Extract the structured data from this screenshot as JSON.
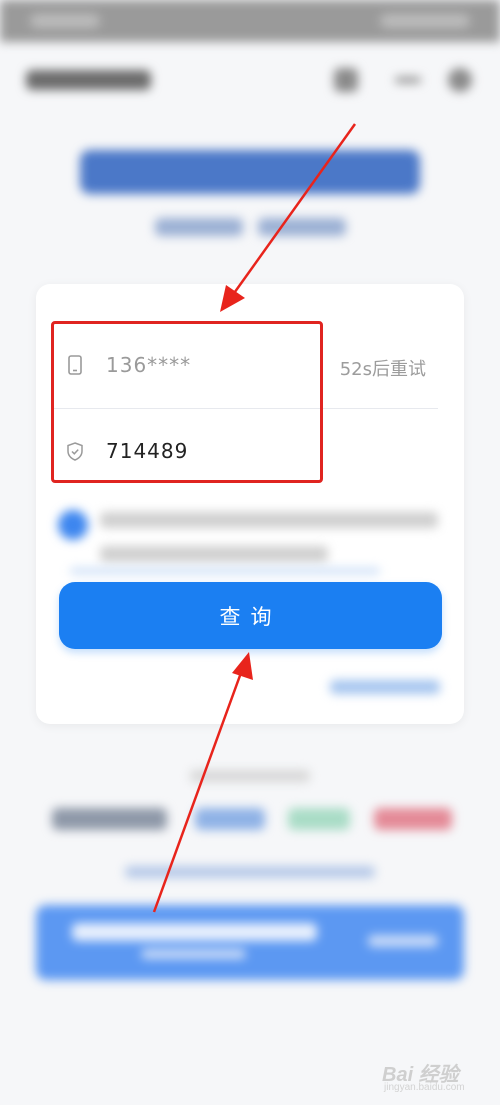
{
  "form": {
    "phone_value": "136****",
    "retry_label": "52s后重试",
    "code_value": "714489"
  },
  "actions": {
    "query_label": "查询"
  },
  "watermark": {
    "brand": "Bai 经验",
    "sub": "jingyan.baidu.com"
  },
  "colors": {
    "accent": "#1b7ff2",
    "highlight": "#e02420"
  },
  "icons": {
    "phone": "phone-icon",
    "code": "shield-icon"
  }
}
